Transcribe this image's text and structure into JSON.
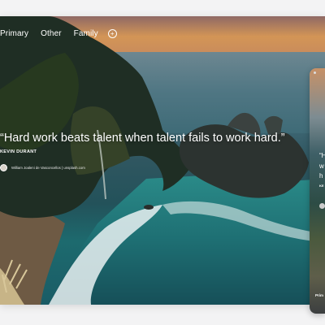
{
  "nav": {
    "tabs": [
      {
        "label": "Primary"
      },
      {
        "label": "Other"
      },
      {
        "label": "Family"
      }
    ],
    "add_icon": "plus-circle-icon"
  },
  "quote": {
    "text": "“Hard work beats talent when talent fails to work hard.”",
    "author": "KEVIN DURANT"
  },
  "photo_credit": {
    "text": "William Joaleni de Vasconcellos | unsplash.com"
  },
  "side_card": {
    "quote_fragments": [
      "“H",
      "w",
      "h"
    ],
    "author_fragment": "KE",
    "nav_fragment": "Prim"
  }
}
